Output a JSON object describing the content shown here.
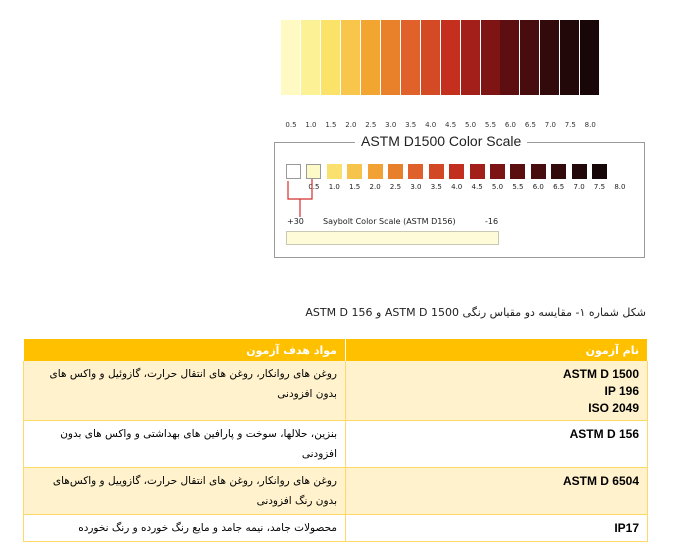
{
  "color_strip": {
    "labels": [
      "0.5",
      "1.0",
      "1.5",
      "2.0",
      "2.5",
      "3.0",
      "3.5",
      "4.0",
      "4.5",
      "5.0",
      "5.5",
      "6.0",
      "6.5",
      "7.0",
      "7.5",
      "8.0"
    ],
    "colors": [
      "#fff9c4",
      "#fdf196",
      "#fbe36a",
      "#f8c64a",
      "#f3a532",
      "#e9802a",
      "#e0622a",
      "#d34a24",
      "#c42f1e",
      "#a3201a",
      "#7e1414",
      "#5c0e10",
      "#460c0e",
      "#320a0c",
      "#23080a",
      "#180608"
    ]
  },
  "astm_box": {
    "title": "ASTM D1500 Color Scale",
    "swatch_colors": [
      "#ffffff",
      "#fefac8",
      "#fae06e",
      "#f7c44b",
      "#f2a134",
      "#e8802b",
      "#df602a",
      "#d24824",
      "#c22f1e",
      "#a21f1a",
      "#7d1414",
      "#5b0e10",
      "#460c0e",
      "#320a0c",
      "#23080a",
      "#170608"
    ],
    "labels": [
      "0.5",
      "1.0",
      "1.5",
      "2.0",
      "2.5",
      "3.0",
      "3.5",
      "4.0",
      "4.5",
      "5.0",
      "5.5",
      "6.0",
      "6.5",
      "7.0",
      "7.5",
      "8.0"
    ],
    "bracket_color": "#d32f2f",
    "saybolt_left": "+30",
    "saybolt_label": "Saybolt Color Scale (ASTM D156)",
    "saybolt_right": "-16"
  },
  "caption": "شکل شماره ۱- مقایسه دو مقیاس رنگی ASTM D 1500 و ASTM D 156",
  "table": {
    "header_color": "#ffc000",
    "headers": [
      "نام آزمون",
      "مواد هدف آزمون"
    ],
    "rows": [
      {
        "name": [
          "ASTM D 1500",
          "IP 196",
          "ISO 2049"
        ],
        "desc": "روغن های روانکار، روغن های انتقال حرارت، گازوئیل و واکس های بدون افزودنی"
      },
      {
        "name": [
          "ASTM D 156"
        ],
        "desc": "بنزین، حلالها، سوخت و پارافین های بهداشتی و واکس های بدون افزودنی"
      },
      {
        "name": [
          "ASTM D 6504"
        ],
        "desc": "روغن های روانکار، روغن های انتقال حرارت، گازوییل و واکس‌های بدون رنگ افزودنی"
      },
      {
        "name": [
          "IP17"
        ],
        "desc": "محصولات جامد، نیمه جامد و مایع رنگ خورده و رنگ نخورده"
      }
    ]
  }
}
